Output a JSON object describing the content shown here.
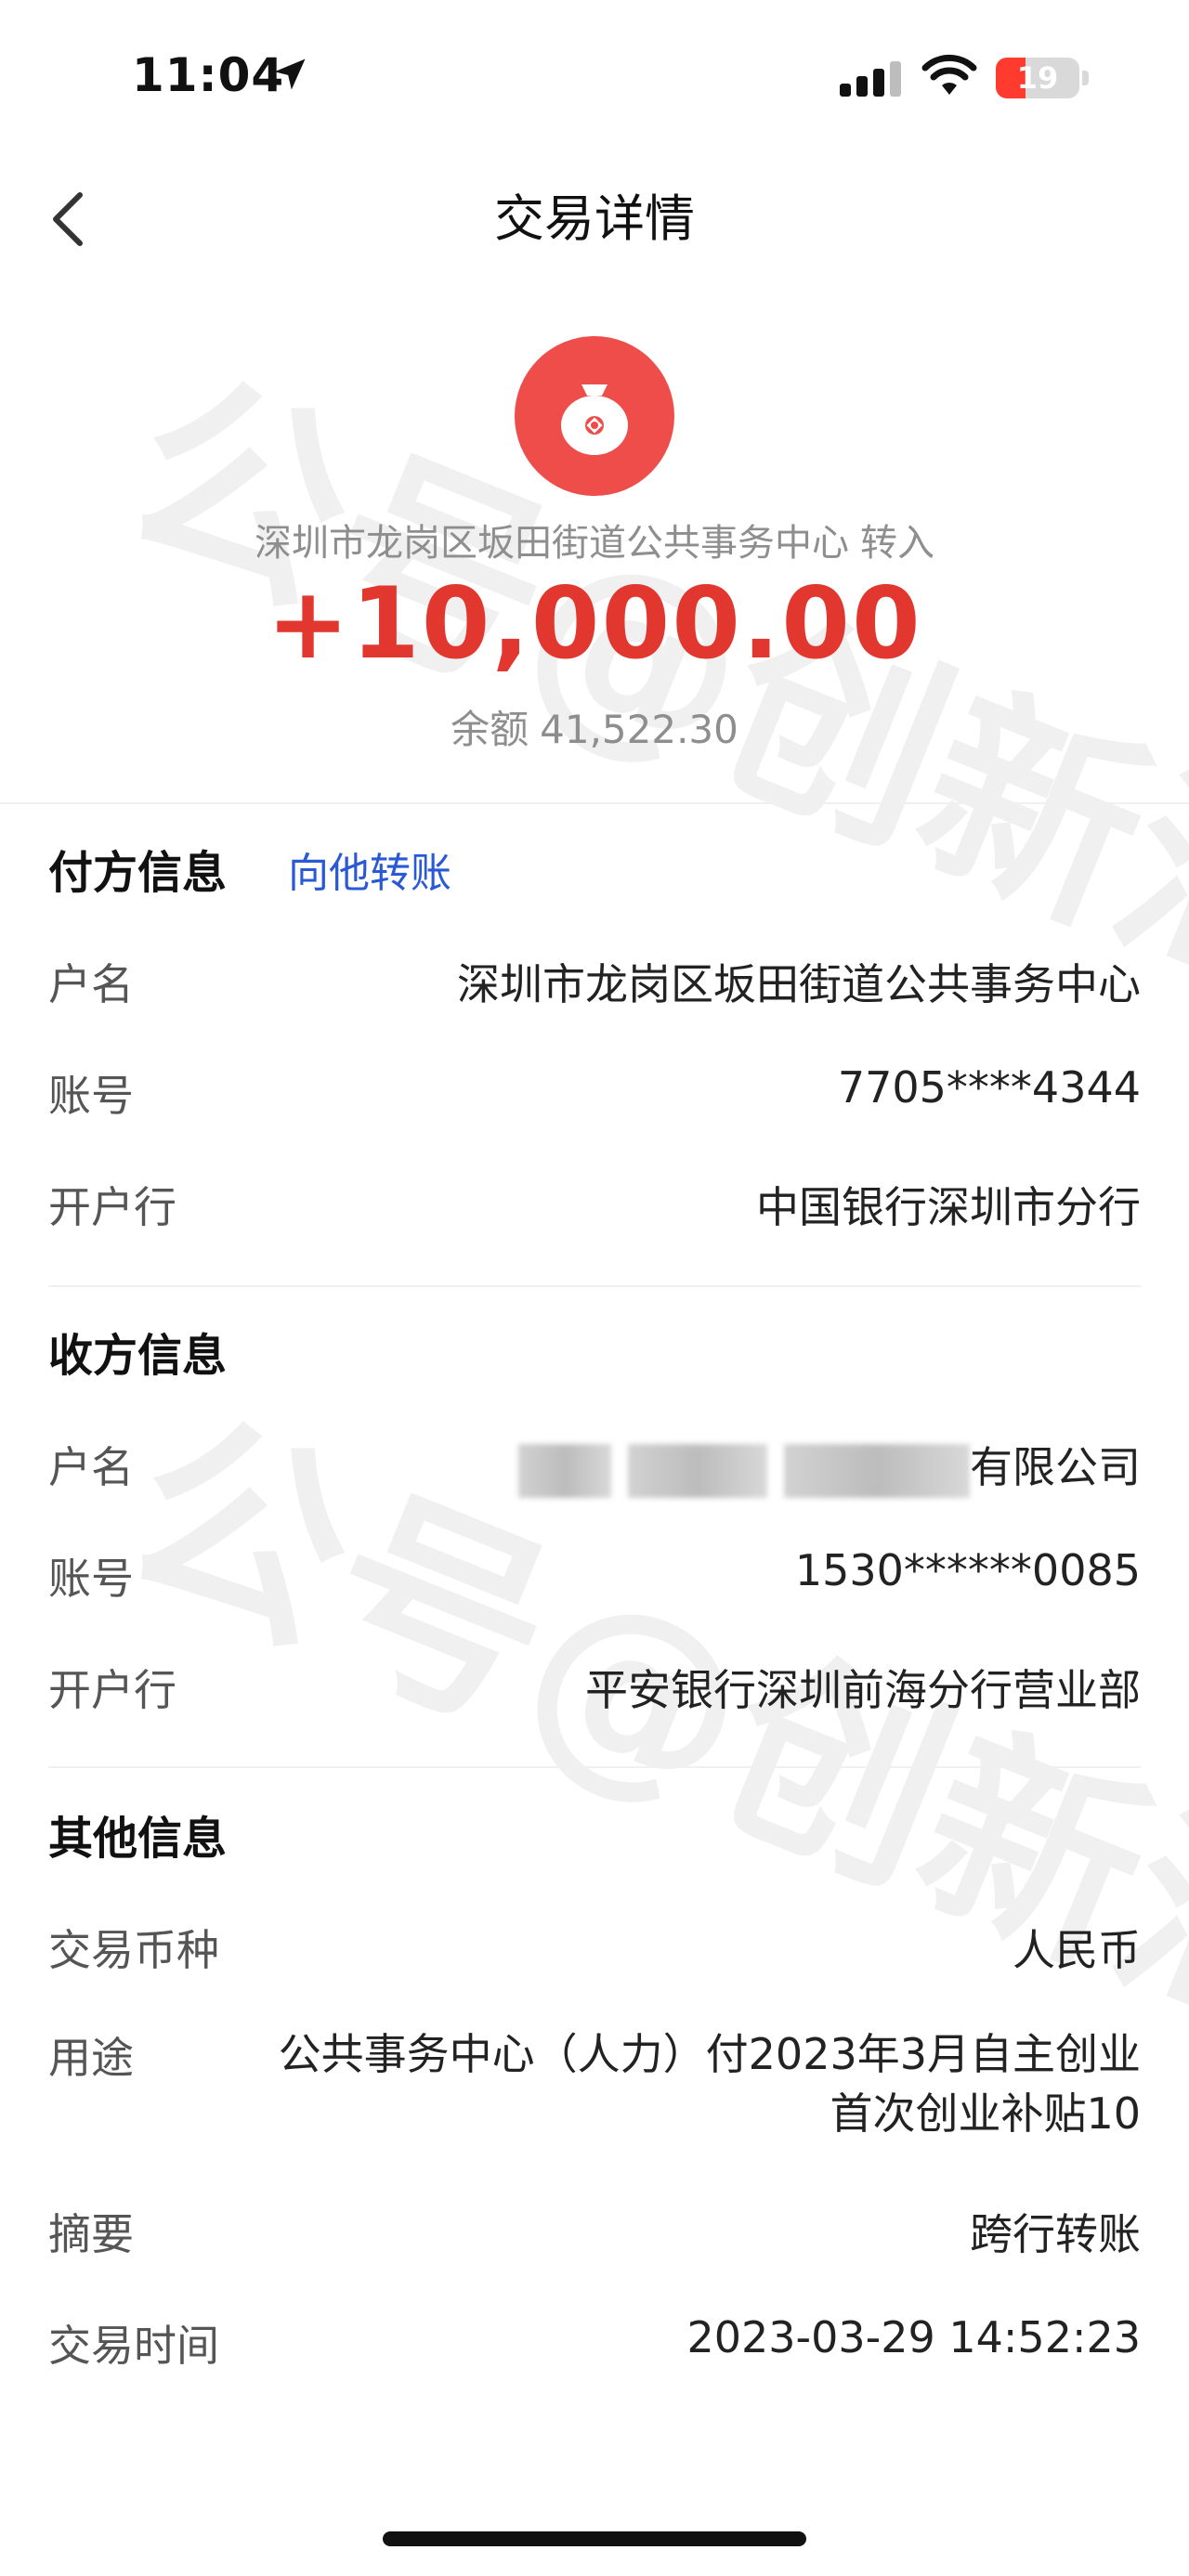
{
  "status_bar": {
    "time": "11:04",
    "battery_level": "19",
    "battery_fraction": 0.19,
    "icons": [
      "location-arrow-icon",
      "signal-icon",
      "wifi-icon",
      "battery-icon"
    ]
  },
  "nav": {
    "title": "交易详情",
    "back_icon": "chevron-left-icon"
  },
  "header": {
    "icon": "money-bag-icon",
    "counterparty_name": "深圳市龙岗区坂田街道公共事务中心",
    "direction": "转入",
    "amount": "+10,000.00",
    "balance_label": "余额",
    "balance_value": "41,522.30",
    "accent_color": "#e1372f"
  },
  "payer": {
    "title": "付方信息",
    "action": "向他转账",
    "rows": [
      {
        "label": "户名",
        "value": "深圳市龙岗区坂田街道公共事务中心"
      },
      {
        "label": "账号",
        "value": "7705****4344"
      },
      {
        "label": "开户行",
        "value": "中国银行深圳市分行"
      }
    ]
  },
  "payee": {
    "title": "收方信息",
    "rows": [
      {
        "label": "户名",
        "value": "有限公司"
      },
      {
        "label": "账号",
        "value": "1530******0085"
      },
      {
        "label": "开户行",
        "value": "平安银行深圳前海分行营业部"
      }
    ]
  },
  "other": {
    "title": "其他信息",
    "rows": [
      {
        "label": "交易币种",
        "value": "人民币"
      },
      {
        "label": "用途",
        "value_line1": "公共事务中心（人力）付2023年3月自主创业",
        "value_line2": "首次创业补贴10"
      },
      {
        "label": "摘要",
        "value": "跨行转账"
      },
      {
        "label": "交易时间",
        "value": "2023-03-29 14:52:23"
      }
    ]
  },
  "watermark": "公号@创新汇"
}
